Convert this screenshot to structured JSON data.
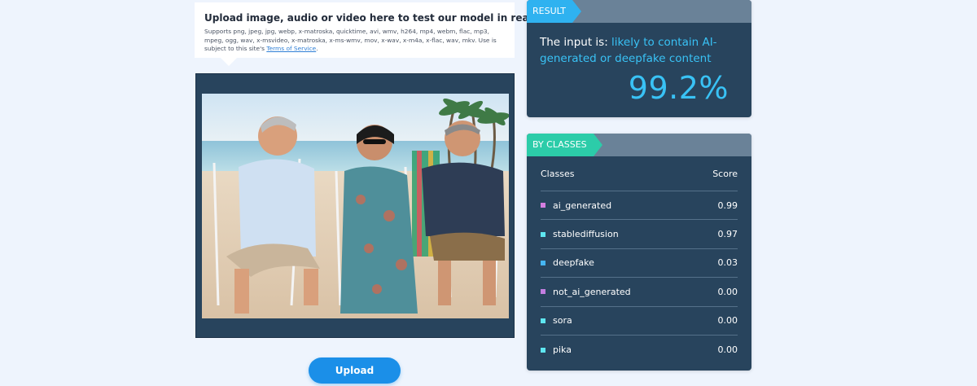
{
  "upload": {
    "heading": "Upload image, audio or video here to test our model in real-time!",
    "description": "Supports png, jpeg, jpg, webp, x-matroska, quicktime, avi, wmv, h264, mp4, webm, flac, mp3, mpeg, ogg, wav, x-msvideo, x-matroska, x-ms-wmv, mov, x-wav, x-m4a, x-flac, wav, mkv. Use is subject to this site's ",
    "terms_link": "Terms of Service",
    "terms_suffix": ".",
    "button_label": "Upload"
  },
  "result": {
    "tag": "RESULT",
    "prefix": "The input is: ",
    "verdict": "likely to contain AI-generated or deepfake content",
    "score": "99.2%"
  },
  "classes": {
    "tag": "BY CLASSES",
    "header_class": "Classes",
    "header_score": "Score",
    "rows": [
      {
        "name": "ai_generated",
        "score": "0.99",
        "color": "#d47ee0"
      },
      {
        "name": "stablediffusion",
        "score": "0.97",
        "color": "#5ee6f0"
      },
      {
        "name": "deepfake",
        "score": "0.03",
        "color": "#45b5f2"
      },
      {
        "name": "not_ai_generated",
        "score": "0.00",
        "color": "#c27ee0"
      },
      {
        "name": "sora",
        "score": "0.00",
        "color": "#5ee6f0"
      },
      {
        "name": "pika",
        "score": "0.00",
        "color": "#5ee6f0"
      }
    ]
  },
  "colors": {
    "page_background": "#eef4fd",
    "panel": "#28445d",
    "result_accent": "#39c2f5",
    "classes_accent": "#2ccca9",
    "button": "#1b8fe8"
  }
}
